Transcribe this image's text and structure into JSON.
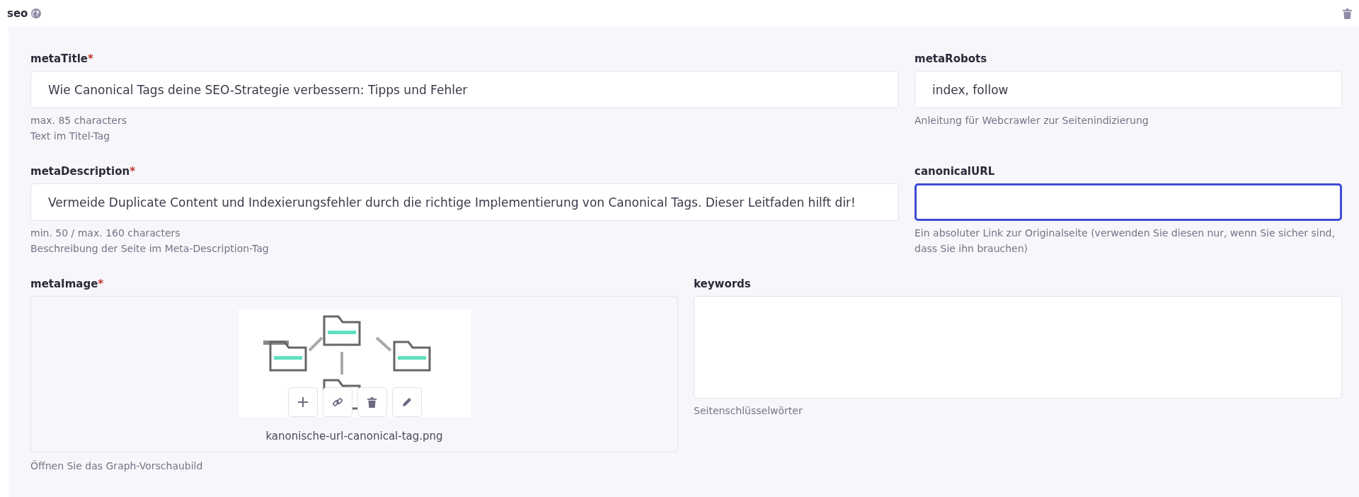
{
  "section": {
    "title": "seo"
  },
  "rows": [
    {
      "fields": [
        {
          "kind": "input",
          "label": "metaTitle",
          "required_mark": "*",
          "value": "Wie Canonical Tags deine SEO-Strategie verbessern: Tipps und Fehler",
          "focused": false,
          "hints": [
            "max. 85 characters",
            "Text im Titel-Tag"
          ]
        },
        {
          "kind": "input",
          "label": "metaRobots",
          "value": "index, follow",
          "focused": false,
          "hints": [
            "Anleitung für Webcrawler zur Seitenindizierung"
          ]
        }
      ]
    },
    {
      "fields": [
        {
          "kind": "input",
          "label": "metaDescription",
          "required_mark": "*",
          "value": "Vermeide Duplicate Content und Indexierungsfehler durch die richtige Implementierung von Canonical Tags. Dieser Leitfaden hilft dir!",
          "focused": false,
          "hints": [
            "min. 50 / max. 160 characters",
            "Beschreibung der Seite im Meta-Description-Tag"
          ]
        },
        {
          "kind": "input",
          "label": "canonicalURL",
          "focused": true,
          "hints": [
            "Ein absoluter Link zur Originalseite (verwenden Sie diesen nur, wenn Sie sicher sind, dass Sie ihn brauchen)"
          ]
        }
      ]
    },
    {
      "fields": [
        {
          "label": "metaImage",
          "required_mark": "*",
          "filename": "kanonische-url-canonical-tag.png",
          "hints": [
            "Öffnen Sie das Graph-Vorschaubild"
          ]
        },
        {
          "kind": "textarea",
          "label": "keywords",
          "focused": false,
          "hints": [
            "Seitenschlüsselwörter"
          ]
        }
      ]
    }
  ]
}
